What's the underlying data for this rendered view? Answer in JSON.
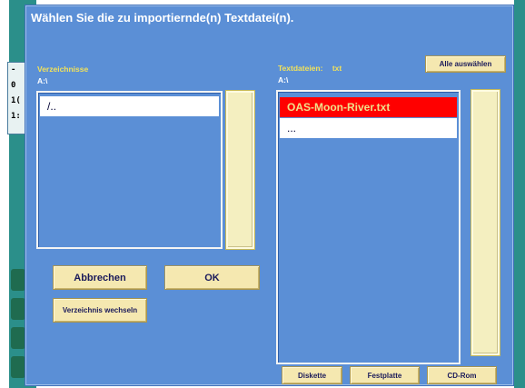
{
  "dialog": {
    "title": "Wählen Sie die zu importiernde(n) Textdatei(n).",
    "directories": {
      "label": "Verzeichnisse",
      "path": "A:\\",
      "items": [
        "/.."
      ]
    },
    "files": {
      "label": "Textdateien:",
      "filter": "txt",
      "path": "A:\\",
      "items": [
        "OAS-Moon-River.txt",
        "..."
      ],
      "selected_index": 0
    },
    "buttons": {
      "select_all": "Alle auswählen",
      "cancel": "Abbrechen",
      "ok": "OK",
      "change_directory": "Verzeichnis wechseln",
      "floppy": "Diskette",
      "harddisk": "Festplatte",
      "cdrom": "CD-Rom"
    }
  },
  "background": {
    "tab_lines": [
      "-",
      "0",
      "1(",
      "1:"
    ]
  },
  "colors": {
    "dialog_bg": "#5b8fd6",
    "label_yellow": "#f2e25a",
    "selection_red": "#ff0000",
    "button_beige": "#f5e8b0",
    "scroll_beige": "#f4efc0"
  }
}
